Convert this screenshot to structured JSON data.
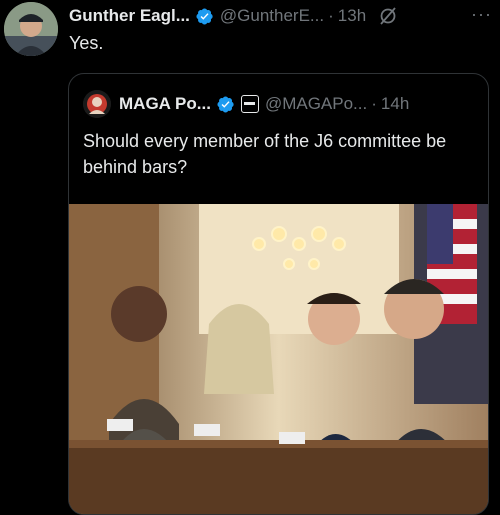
{
  "tweet": {
    "author_name": "Gunther Eagl...",
    "author_handle": "@GuntherE...",
    "separator": "·",
    "time": "13h",
    "more_label": "···",
    "text": "Yes."
  },
  "quote": {
    "author_name": "MAGA Po...",
    "author_handle": "@MAGAPo...",
    "separator": "·",
    "time": "14h",
    "text": "Should every member of the J6 committee be behind bars?"
  },
  "colors": {
    "background": "#000000",
    "text": "#e7e9ea",
    "muted": "#71767b",
    "verified": "#1d9bf0",
    "border": "#2f3336"
  }
}
